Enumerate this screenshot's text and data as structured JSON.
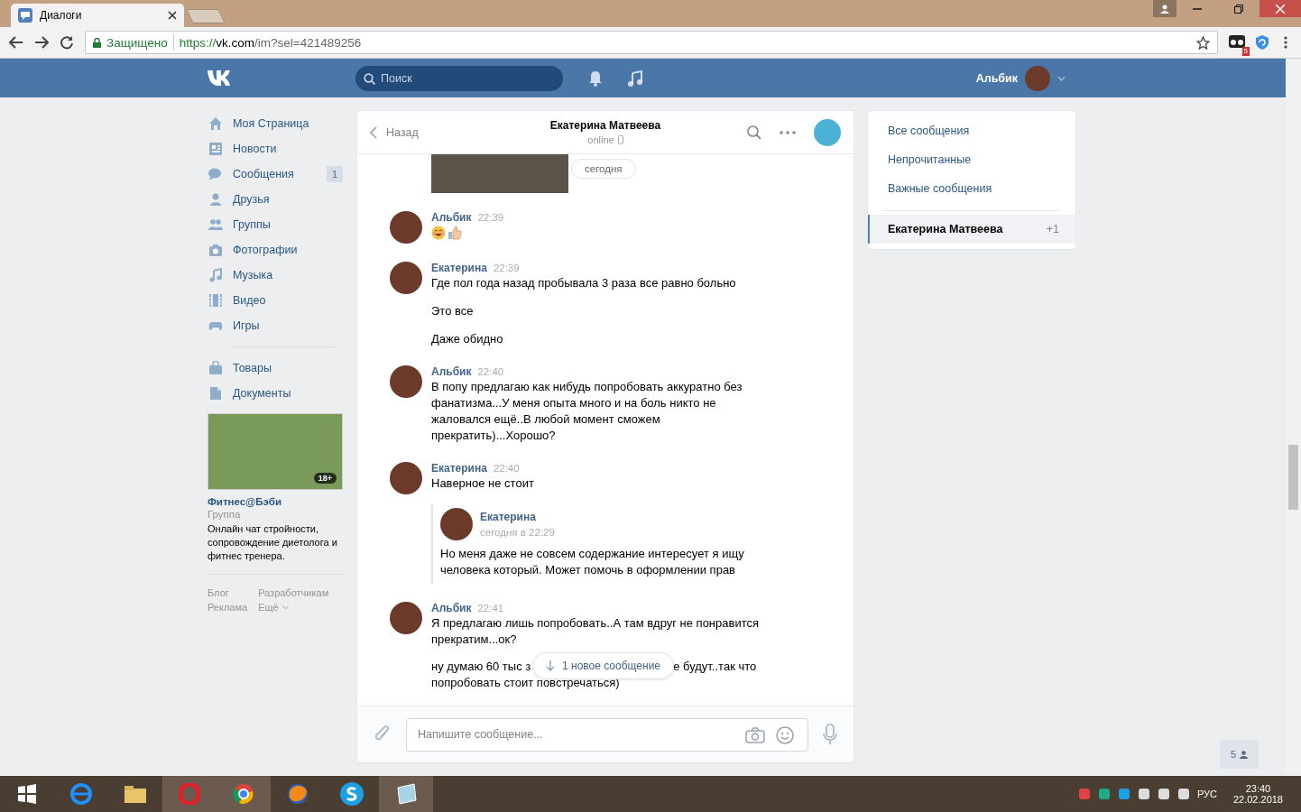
{
  "browser": {
    "tab_title": "Диалоги",
    "secure_label": "Защищено",
    "url_scheme": "https://",
    "url_host": "vk.com",
    "url_path": "/im?sel=421489256",
    "extension_badge": "5"
  },
  "header": {
    "search_placeholder": "Поиск",
    "user_name": "Альбик"
  },
  "sidebar": {
    "groups": [
      [
        {
          "label": "Моя Страница"
        },
        {
          "label": "Новости"
        },
        {
          "label": "Сообщения",
          "badge": "1"
        },
        {
          "label": "Друзья"
        },
        {
          "label": "Группы"
        },
        {
          "label": "Фотографии"
        },
        {
          "label": "Музыка"
        },
        {
          "label": "Видео"
        },
        {
          "label": "Игры"
        }
      ],
      [
        {
          "label": "Товары"
        },
        {
          "label": "Документы"
        }
      ]
    ],
    "ad": {
      "badge": "18+",
      "title": "Фитнес@Бэби",
      "subtitle": "Группа",
      "description": "Онлайн чат стройности, сопровождение диетолога и фитнес тренера."
    },
    "footer_links": [
      "Блог",
      "Разработчикам",
      "Реклама",
      "Ещё"
    ]
  },
  "chat": {
    "back": "Назад",
    "title": "Екатерина Матвеева",
    "status": "online",
    "date_pill": "сегодня",
    "messages": [
      {
        "kind": "emoji",
        "author": "Альбик",
        "time": "22:39"
      },
      {
        "kind": "text",
        "author": "Екатерина",
        "time": "22:39",
        "paragraphs": [
          "Где пол года назад пробывала 3 раза все равно больно",
          "Это все",
          "Даже обидно"
        ]
      },
      {
        "kind": "text",
        "author": "Альбик",
        "time": "22:40",
        "paragraphs": [
          "В попу предлагаю как нибудь попробовать аккуратно без фанатизма...У меня опыта много и на боль никто не жаловался ещё..В любой момент сможем прекратить)...Хорошо?"
        ]
      },
      {
        "kind": "forward",
        "author": "Екатерина",
        "time": "22:40",
        "paragraphs": [
          "Наверное не стоит"
        ],
        "forwarded": {
          "author": "Екатерина",
          "time": "сегодня в 22:29",
          "text": "Но меня даже не совсем содержание интересует я ищу человека который. Может помочь в оформлении прав"
        }
      },
      {
        "kind": "covered",
        "author": "Альбик",
        "time": "22:41",
        "paragraphs": [
          "Я предлагаю лишь попробовать..А там вдруг не понравится прекратим...ок?"
        ],
        "covered_fragments": [
          "ну думаю 60 тыс з",
          "е будут..так что",
          "попробовать стоит повстречаться)"
        ]
      }
    ],
    "new_messages_button": "1 новое сообщение",
    "composer_placeholder": "Напишите сообщение..."
  },
  "right_menu": {
    "items": [
      {
        "label": "Все сообщения",
        "selected": false
      },
      {
        "label": "Непрочитанные",
        "selected": false
      },
      {
        "label": "Важные сообщения",
        "selected": false
      }
    ],
    "conversations": [
      {
        "label": "Екатерина Матвеева",
        "count": "+1",
        "selected": true
      }
    ]
  },
  "online_friends_badge": "5",
  "taskbar": {
    "language": "РУС",
    "time": "23:40",
    "date": "22.02.2018"
  }
}
